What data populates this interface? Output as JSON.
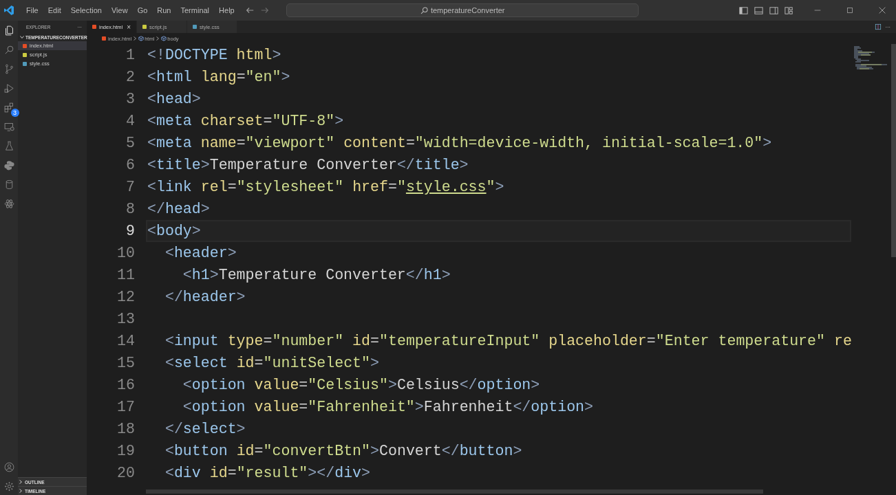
{
  "menu": [
    "File",
    "Edit",
    "Selection",
    "View",
    "Go",
    "Run",
    "Terminal",
    "Help"
  ],
  "command_center": {
    "value": "temperatureConverter"
  },
  "activity_bar": {
    "extensions_badge": "3"
  },
  "sidebar": {
    "title": "EXPLORER",
    "more": "···",
    "folder": {
      "label": "TEMPERATURECONVERTER",
      "expanded": true,
      "children": [
        {
          "label": "index.html",
          "kind": "html",
          "selected": true
        },
        {
          "label": "script.js",
          "kind": "js",
          "selected": false
        },
        {
          "label": "style.css",
          "kind": "css",
          "selected": false
        }
      ]
    },
    "panels": [
      {
        "label": "OUTLINE",
        "expanded": false
      },
      {
        "label": "TIMELINE",
        "expanded": false
      }
    ]
  },
  "tabs": [
    {
      "label": "index.html",
      "kind": "html",
      "selected": true,
      "close": "×"
    },
    {
      "label": "script.js",
      "kind": "js",
      "selected": false
    },
    {
      "label": "style.css",
      "kind": "css",
      "selected": false
    }
  ],
  "editor_actions": {
    "more": "···"
  },
  "breadcrumbs": [
    {
      "label": "index.html",
      "kind": "html"
    },
    {
      "label": "html",
      "kind": "element"
    },
    {
      "label": "body",
      "kind": "element"
    }
  ],
  "lines": [
    {
      "number": "1",
      "current": false,
      "kind": "code",
      "text": "<!DOCTYPE html>"
    },
    {
      "number": "2",
      "current": false,
      "kind": "code",
      "text": "<html lang=\"en\">"
    },
    {
      "number": "3",
      "current": false,
      "kind": "code",
      "text": "<head>"
    },
    {
      "number": "4",
      "current": false,
      "kind": "code",
      "text": "<meta charset=\"UTF-8\">"
    },
    {
      "number": "5",
      "current": false,
      "kind": "code",
      "text": "<meta name=\"viewport\" content=\"width=device-width, initial-scale=1.0\">"
    },
    {
      "number": "6",
      "current": false,
      "kind": "code",
      "text": "<title>Temperature Converter</title>"
    },
    {
      "number": "7",
      "current": false,
      "kind": "link",
      "text": "<link rel=\"stylesheet\" href=\"style.css\">"
    },
    {
      "number": "8",
      "current": false,
      "kind": "code",
      "text": "</head>"
    },
    {
      "number": "9",
      "current": true,
      "kind": "code",
      "text": "<body>"
    },
    {
      "number": "10",
      "current": false,
      "kind": "code",
      "text": "  <header>"
    },
    {
      "number": "11",
      "current": false,
      "kind": "code",
      "text": "    <h1>Temperature Converter</h1>"
    },
    {
      "number": "12",
      "current": false,
      "kind": "code",
      "text": "  </header>"
    },
    {
      "number": "13",
      "current": false
    },
    {
      "number": "14",
      "current": false,
      "kind": "code",
      "text": "  <input type=\"number\" id=\"temperatureInput\" placeholder=\"Enter temperature\" re"
    },
    {
      "number": "15",
      "current": false,
      "kind": "code",
      "text": "  <select id=\"unitSelect\">"
    },
    {
      "number": "16",
      "current": false,
      "kind": "code",
      "text": "    <option value=\"Celsius\">Celsius</option>"
    },
    {
      "number": "17",
      "current": false,
      "kind": "code",
      "text": "    <option value=\"Fahrenheit\">Fahrenheit</option>"
    },
    {
      "number": "18",
      "current": false,
      "kind": "code",
      "text": "  </select>"
    },
    {
      "number": "19",
      "current": false,
      "kind": "code",
      "text": "  <button id=\"convertBtn\">Convert</button>"
    },
    {
      "number": "20",
      "current": false,
      "kind": "code",
      "text": "  <div id=\"result\"></div>"
    }
  ]
}
